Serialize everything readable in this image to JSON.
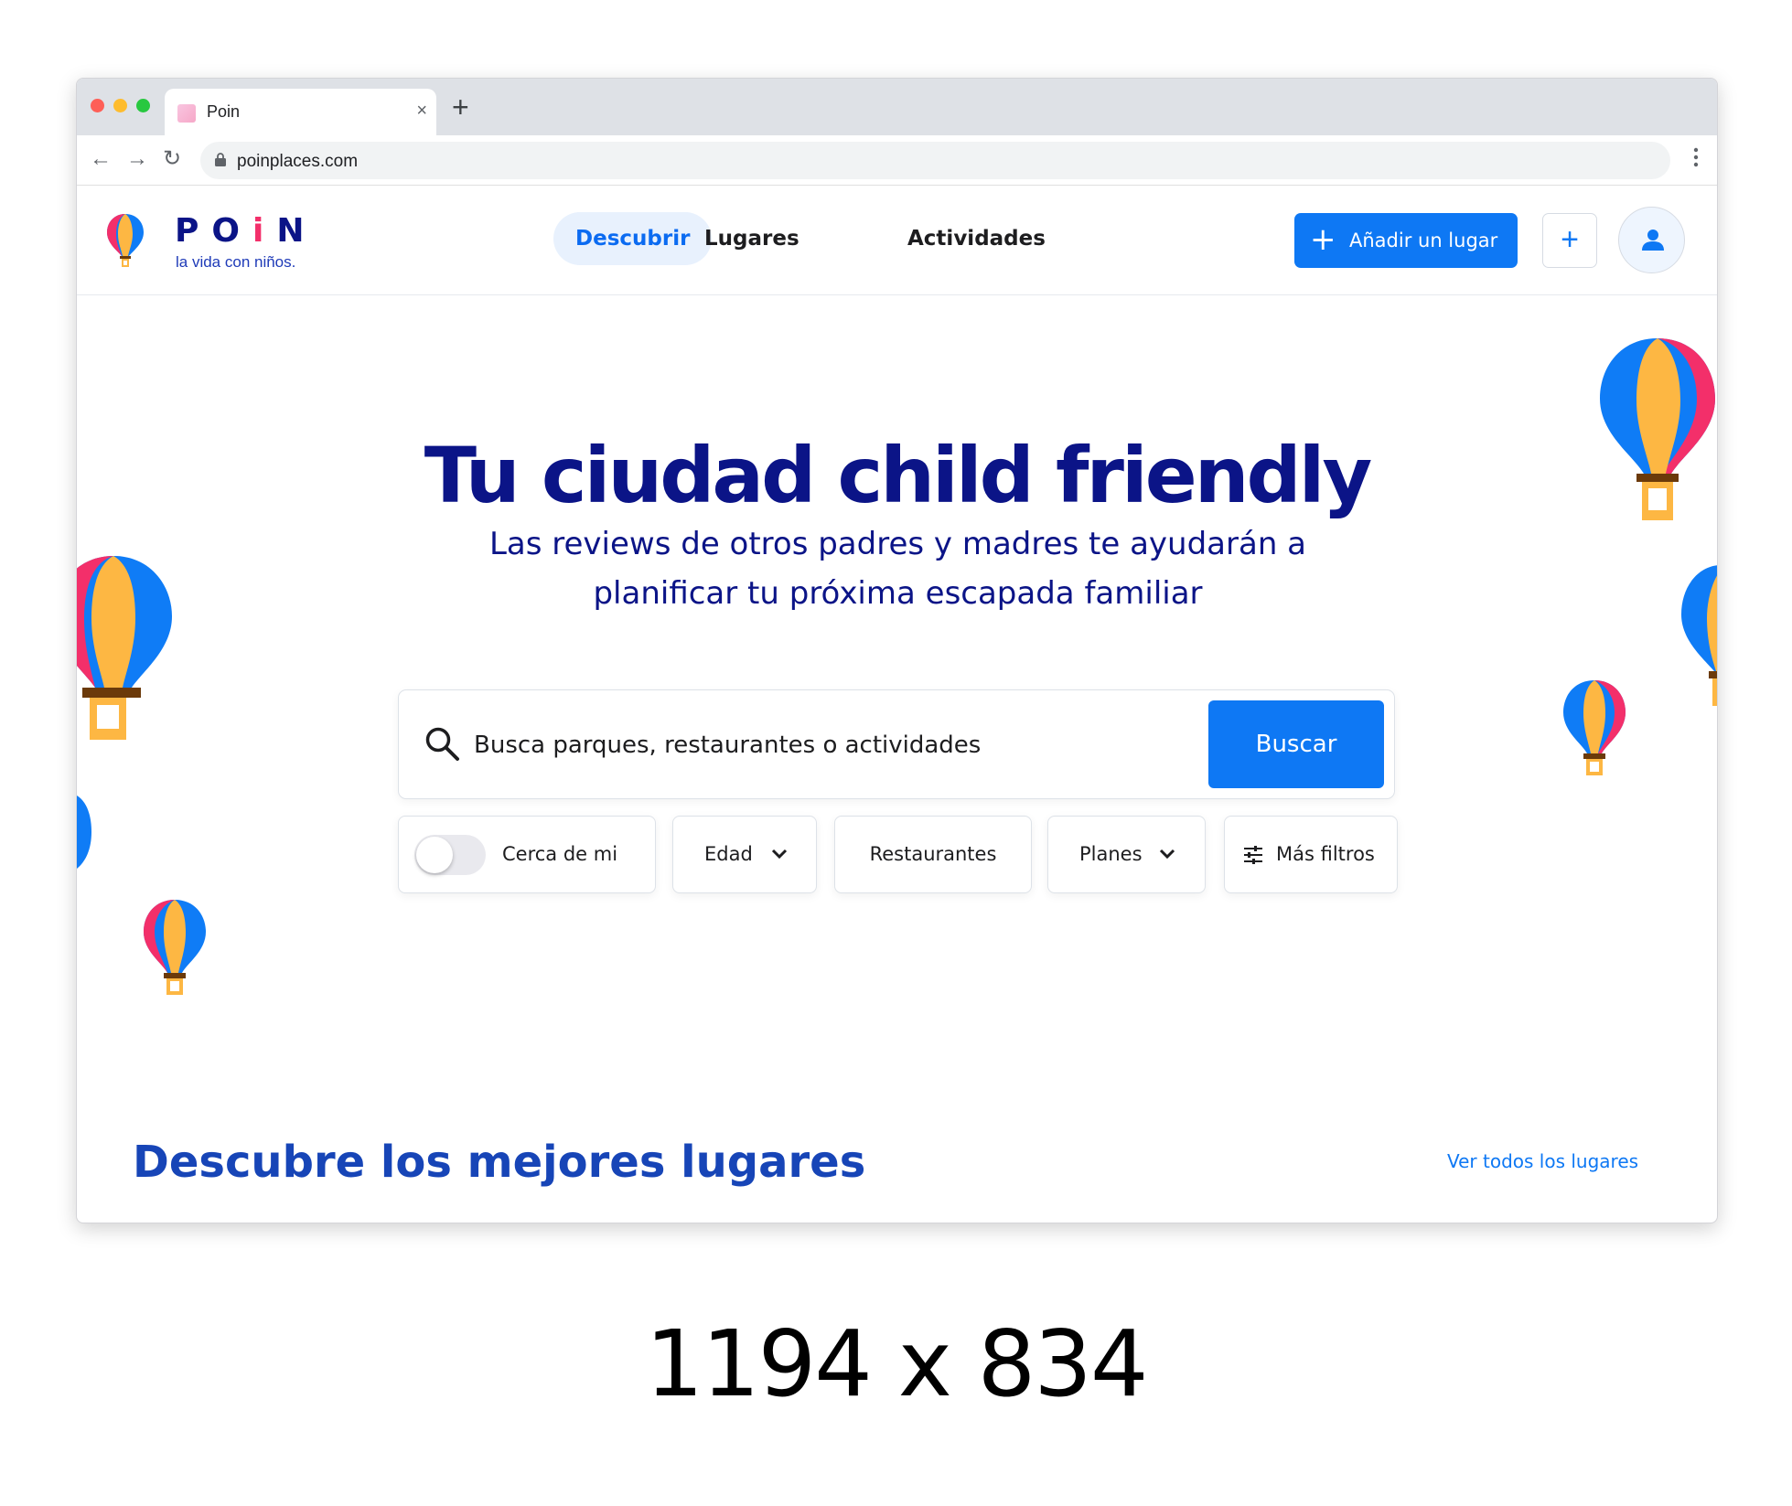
{
  "browser": {
    "tab_title": "Poin",
    "tab_close": "×",
    "new_tab": "+",
    "url": "poinplaces.com",
    "nav_back": "←",
    "nav_forward": "→",
    "nav_reload": "↻"
  },
  "header": {
    "logo_letters": [
      "P",
      "O",
      "i",
      "N"
    ],
    "logo_tagline": "la vida con niños.",
    "nav": [
      {
        "label": "Descubrir",
        "active": true
      },
      {
        "label": "Lugares",
        "active": false
      },
      {
        "label": "Actividades",
        "active": false
      }
    ],
    "add_place_label": "Añadir un lugar",
    "plus_label": "+"
  },
  "hero": {
    "title": "Tu ciudad child friendly",
    "subtitle": "Las reviews de otros padres y madres te ayudarán a planificar tu próxima escapada familiar",
    "search_placeholder": "Busca parques, restaurantes o actividades",
    "search_button": "Buscar",
    "filters": {
      "near_me": "Cerca de mi",
      "age": "Edad",
      "restaurants": "Restaurantes",
      "plans": "Planes",
      "more_filters": "Más filtros"
    }
  },
  "section": {
    "title": "Descubre los mejores lugares",
    "see_all": "Ver todos los lugares"
  },
  "caption": "1194 x 834",
  "colors": {
    "brand_navy": "#0b1487",
    "primary_blue": "#0e78f4",
    "balloon_blue": "#0f7cf6",
    "balloon_yellow": "#fdb743",
    "balloon_pink": "#f32f6a",
    "balloon_basket": "#6b3a0a"
  }
}
